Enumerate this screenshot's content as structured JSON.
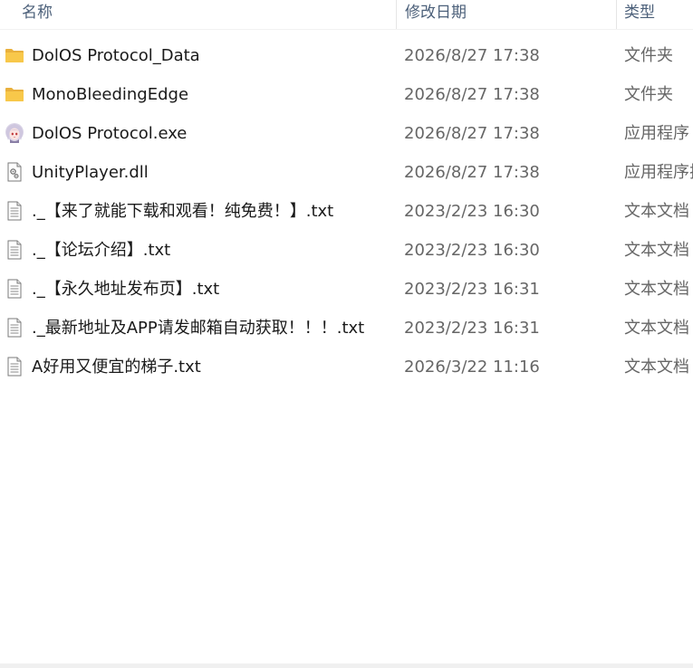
{
  "columns": {
    "name": "名称",
    "date": "修改日期",
    "type": "类型"
  },
  "files": [
    {
      "name": "DolOS Protocol_Data",
      "date": "2026/8/27 17:38",
      "type": "文件夹",
      "icon": "folder-icon"
    },
    {
      "name": "MonoBleedingEdge",
      "date": "2026/8/27 17:38",
      "type": "文件夹",
      "icon": "folder-icon"
    },
    {
      "name": "DolOS Protocol.exe",
      "date": "2026/8/27 17:38",
      "type": "应用程序",
      "icon": "app-icon"
    },
    {
      "name": "UnityPlayer.dll",
      "date": "2026/8/27 17:38",
      "type": "应用程序扩",
      "icon": "dll-icon"
    },
    {
      "name": "._【来了就能下载和观看！纯免费！】.txt",
      "date": "2023/2/23 16:30",
      "type": "文本文档",
      "icon": "text-file-icon"
    },
    {
      "name": "._【论坛介绍】.txt",
      "date": "2023/2/23 16:30",
      "type": "文本文档",
      "icon": "text-file-icon"
    },
    {
      "name": "._【永久地址发布页】.txt",
      "date": "2023/2/23 16:31",
      "type": "文本文档",
      "icon": "text-file-icon"
    },
    {
      "name": "._最新地址及APP请发邮箱自动获取！！！.txt",
      "date": "2023/2/23 16:31",
      "type": "文本文档",
      "icon": "text-file-icon"
    },
    {
      "name": "A好用又便宜的梯子.txt",
      "date": "2026/3/22 11:16",
      "type": "文本文档",
      "icon": "text-file-icon"
    }
  ],
  "colors": {
    "folder": "#f8c84a",
    "header_text": "#4c607a",
    "secondary_text": "#666666"
  }
}
